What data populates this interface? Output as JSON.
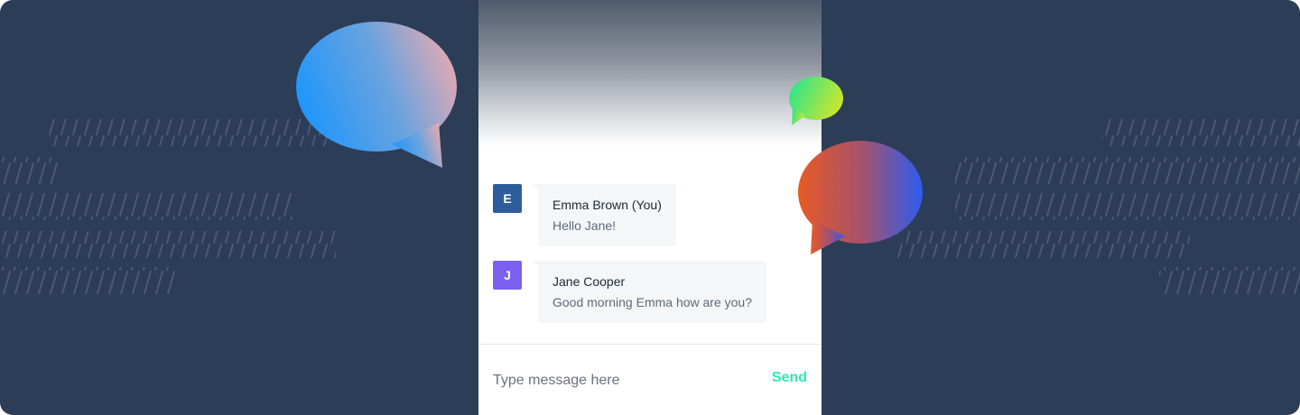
{
  "chat": {
    "messages": [
      {
        "initial": "E",
        "sender": "Emma Brown (You)",
        "text": "Hello Jane!",
        "avatar_color": "#2f5d9b"
      },
      {
        "initial": "J",
        "sender": "Jane Cooper",
        "text": "Good morning Emma how are you?",
        "avatar_color": "#7b61f0"
      }
    ],
    "composer": {
      "placeholder": "Type message here",
      "send_label": "Send",
      "send_color": "#2ce8b4"
    }
  },
  "colors": {
    "background": "#2c3d57",
    "stripe": "#4a5a73"
  },
  "decorations": [
    {
      "name": "blue-pink-chat-bubble-icon"
    },
    {
      "name": "green-chat-bubble-icon"
    },
    {
      "name": "orange-blue-chat-bubble-icon"
    }
  ]
}
